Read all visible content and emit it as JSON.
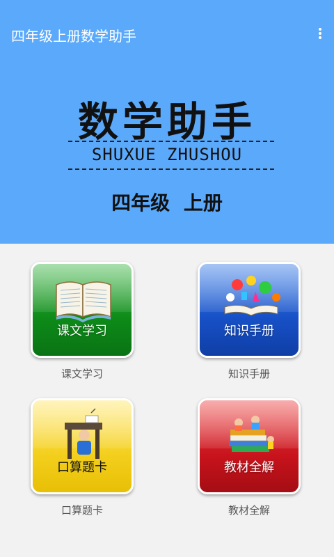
{
  "appbar": {
    "title": "四年级上册数学助手"
  },
  "logo": {
    "title": "数学助手",
    "pinyin": "SHUXUE ZHUSHOU",
    "grade": "四年级 上册"
  },
  "tiles": [
    {
      "label": "课文学习",
      "caption": "课文学习",
      "icon": "open-book-icon"
    },
    {
      "label": "知识手册",
      "caption": "知识手册",
      "icon": "numbers-book-icon"
    },
    {
      "label": "口算题卡",
      "caption": "口算题卡",
      "icon": "student-desk-icon"
    },
    {
      "label": "教材全解",
      "caption": "教材全解",
      "icon": "kids-on-books-icon"
    }
  ],
  "colors": {
    "banner": "#5aa9fb",
    "green": "#0d8a18",
    "blue": "#1750c6",
    "yellow": "#f3cf1d",
    "red": "#c8131c"
  }
}
